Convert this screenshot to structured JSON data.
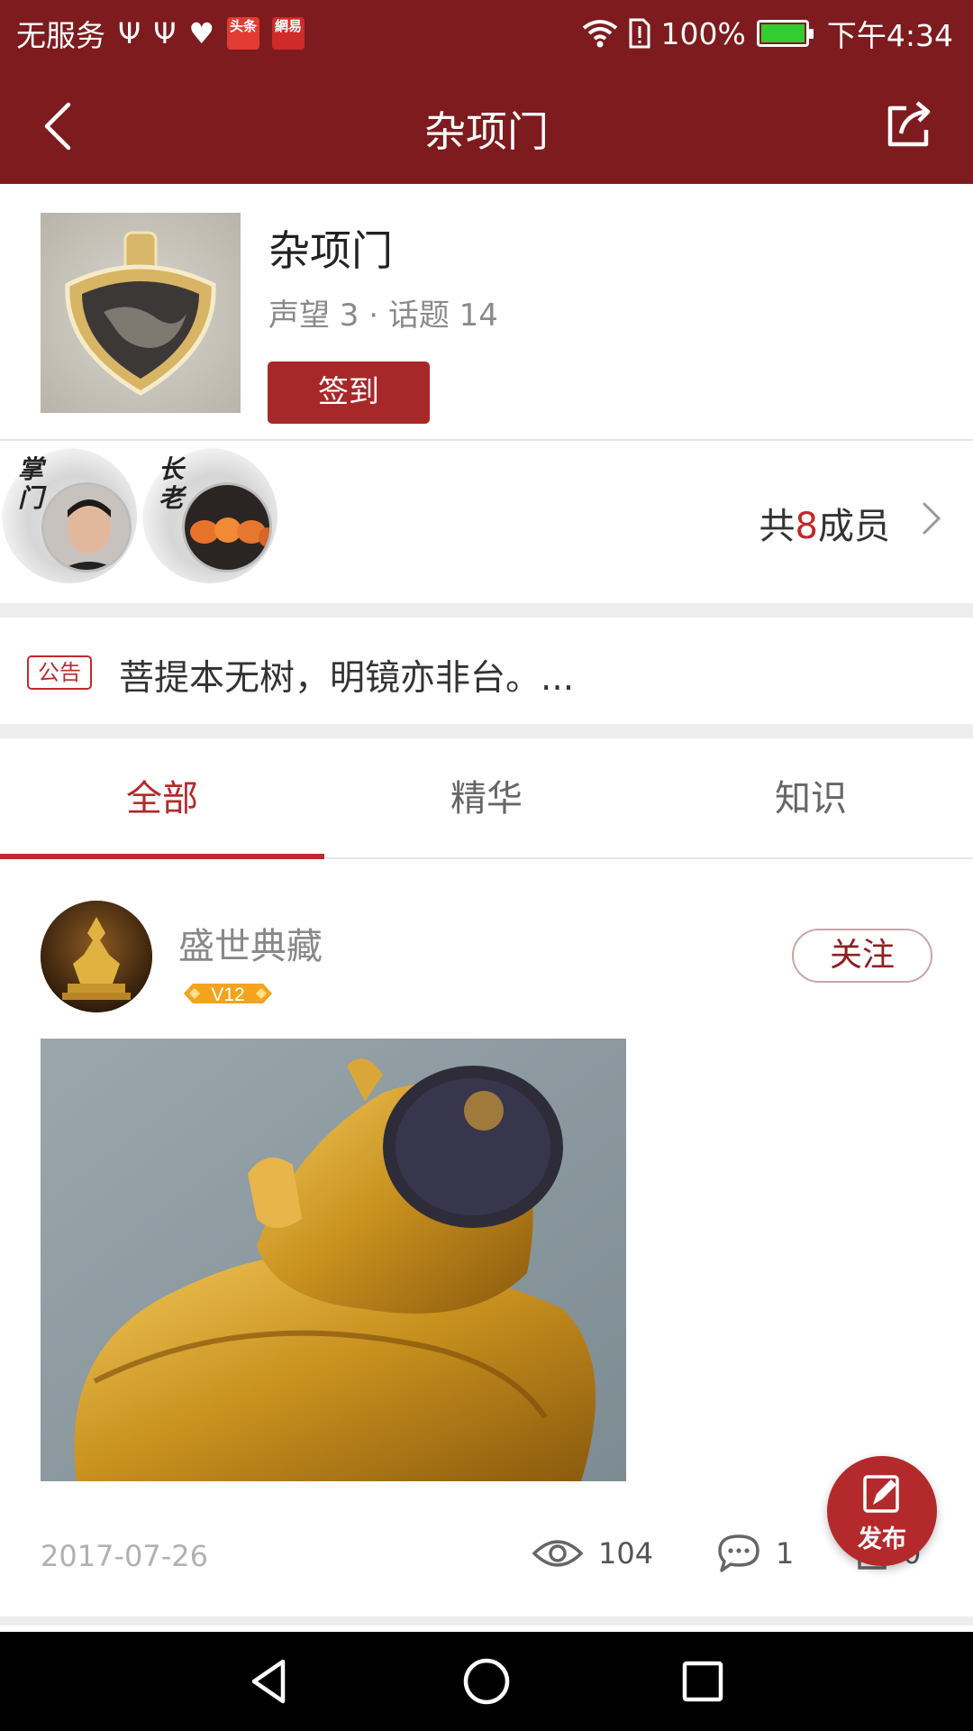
{
  "status_bar": {
    "carrier": "无服务",
    "news_badge_1": "头条",
    "news_badge_2": "網易",
    "battery": "100%",
    "time": "下午4:34"
  },
  "app_bar": {
    "title": "杂项门",
    "back_icon": "chevron-left-icon",
    "share_icon": "share-icon"
  },
  "group": {
    "name": "杂项门",
    "meta": "声望 3 · 话题 14",
    "signin_label": "签到"
  },
  "members": {
    "tag_master": "掌门",
    "tag_elder": "长老",
    "count_prefix": "共",
    "count_number": "8",
    "count_suffix": "成员"
  },
  "notice": {
    "tag": "公告",
    "text": "菩提本无树，明镜亦非台。..."
  },
  "tabs": [
    {
      "label": "全部",
      "active": true
    },
    {
      "label": "精华",
      "active": false
    },
    {
      "label": "知识",
      "active": false
    }
  ],
  "post": {
    "author": "盛世典藏",
    "level": "V12",
    "follow_label": "关注",
    "date": "2017-07-26",
    "views": "104",
    "comments": "1",
    "shares": "0"
  },
  "fab": {
    "label": "发布"
  },
  "colors": {
    "header": "#7d1b1e",
    "accent": "#c0292b",
    "button": "#a8282a"
  }
}
